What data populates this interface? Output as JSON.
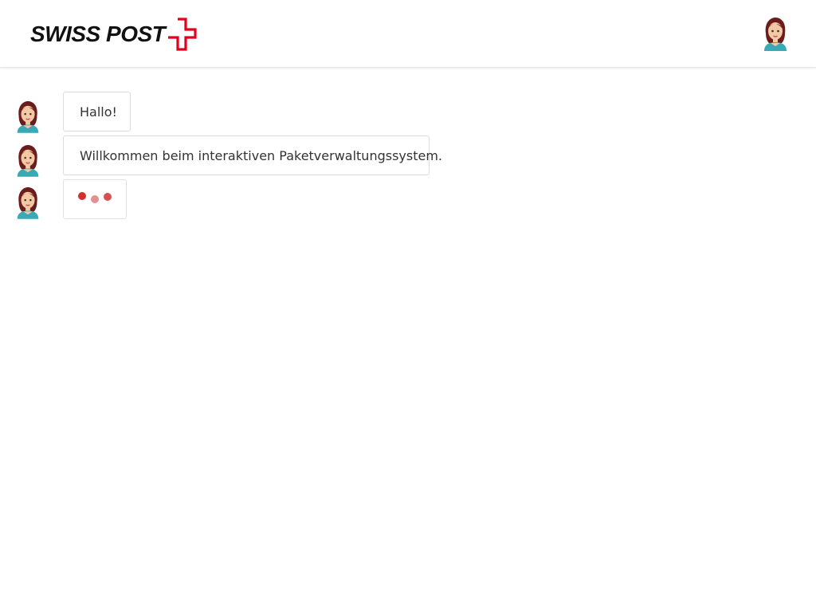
{
  "header": {
    "logo_text": "SWISS POST",
    "brand_color": "#e2001a",
    "avatar_icon": "user-avatar-icon"
  },
  "chat": {
    "messages": [
      {
        "sender": "assistant",
        "avatar_icon": "assistant-avatar-icon",
        "text": "Hallo!"
      },
      {
        "sender": "assistant",
        "avatar_icon": "assistant-avatar-icon",
        "text": "Willkommen beim interaktiven Paketverwaltungssystem."
      },
      {
        "sender": "assistant",
        "avatar_icon": "assistant-avatar-icon",
        "status": "typing"
      }
    ]
  },
  "colors": {
    "dot_primary": "#d32f2f",
    "dot_light": "#e39090",
    "avatar_hair": "#6b1d1d",
    "avatar_skin": "#f3c9a5",
    "avatar_shirt": "#3aa9b6"
  }
}
